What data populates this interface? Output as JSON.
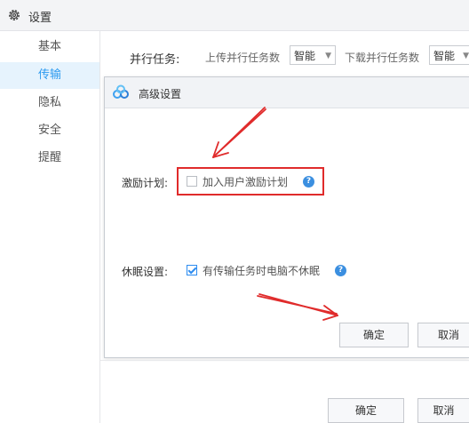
{
  "window": {
    "title": "设置"
  },
  "sidebar": {
    "items": [
      {
        "label": "基本",
        "active": false
      },
      {
        "label": "传输",
        "active": true
      },
      {
        "label": "隐私",
        "active": false
      },
      {
        "label": "安全",
        "active": false
      },
      {
        "label": "提醒",
        "active": false
      }
    ]
  },
  "parallel": {
    "label": "并行任务:",
    "upload_label": "上传并行任务数",
    "upload_value": "智能",
    "download_label": "下载并行任务数",
    "download_value": "智能"
  },
  "dialog": {
    "title": "高级设置",
    "incentive": {
      "label": "激励计划:",
      "checkbox_text": "加入用户激励计划",
      "checked": false
    },
    "sleep": {
      "label": "休眠设置:",
      "checkbox_text": "有传输任务时电脑不休眠",
      "checked": true
    },
    "confirm_label": "确定",
    "cancel_label": "取消"
  },
  "footer": {
    "confirm_label": "确定",
    "cancel_label": "取消"
  },
  "colors": {
    "accent": "#2d9bf0",
    "annotation": "#e02b2b"
  }
}
